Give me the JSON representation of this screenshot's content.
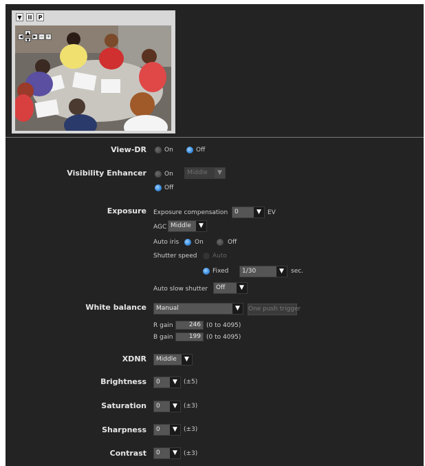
{
  "preview": {
    "controls": [
      {
        "name": "menu-icon",
        "glyph": "▼"
      },
      {
        "name": "pause-icon",
        "glyph": "II"
      },
      {
        "name": "p-icon",
        "glyph": "P"
      }
    ]
  },
  "view_dr": {
    "label": "View-DR",
    "on": "On",
    "off": "Off",
    "selected": "off"
  },
  "visibility": {
    "label": "Visibility Enhancer",
    "on": "On",
    "off": "Off",
    "mode_value": "Middle",
    "selected": "off"
  },
  "exposure": {
    "label": "Exposure",
    "comp_label": "Exposure compensation",
    "comp_value": "0",
    "comp_unit": "EV",
    "agc_label": "AGC",
    "agc_value": "Middle",
    "iris_label": "Auto iris",
    "iris_on": "On",
    "iris_off": "Off",
    "shutter_label": "Shutter speed",
    "shutter_auto": "Auto",
    "shutter_fixed": "Fixed",
    "shutter_value": "1/30",
    "shutter_unit": "sec.",
    "slow_label": "Auto slow shutter",
    "slow_value": "Off"
  },
  "white_balance": {
    "label": "White balance",
    "mode": "Manual",
    "trigger": "One push trigger",
    "r_label": "R gain",
    "r_value": "246",
    "r_range": "(0 to 4095)",
    "b_label": "B gain",
    "b_value": "199",
    "b_range": "(0 to 4095)"
  },
  "xdnr": {
    "label": "XDNR",
    "value": "Middle"
  },
  "brightness": {
    "label": "Brightness",
    "value": "0",
    "range": "(±5)"
  },
  "saturation": {
    "label": "Saturation",
    "value": "0",
    "range": "(±3)"
  },
  "sharpness": {
    "label": "Sharpness",
    "value": "0",
    "range": "(±3)"
  },
  "contrast": {
    "label": "Contrast",
    "value": "0",
    "range": "(±3)"
  }
}
